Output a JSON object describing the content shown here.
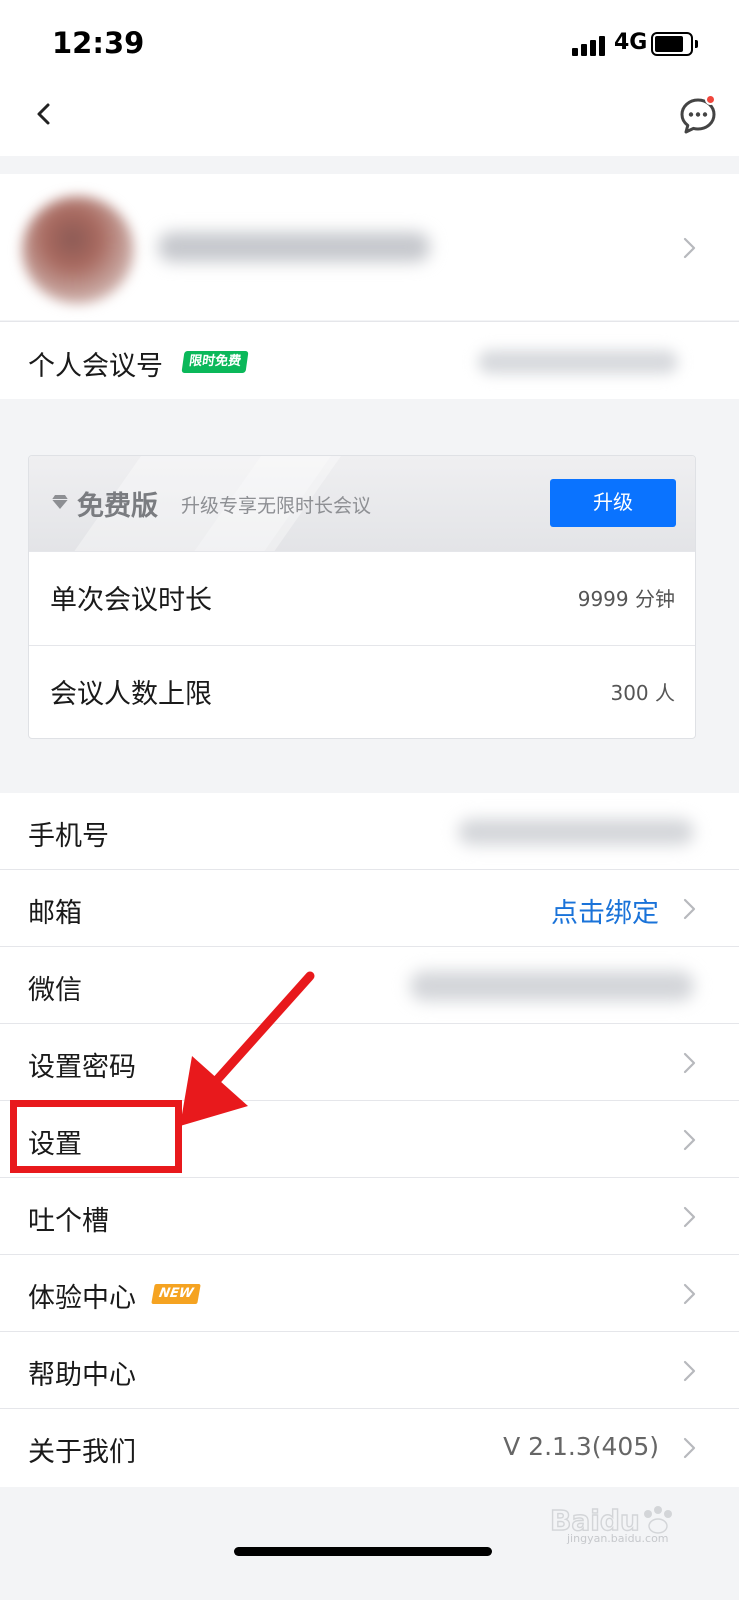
{
  "status_bar": {
    "time": "12:39",
    "network": "4G"
  },
  "nav": {
    "back_icon": "chevron-left-icon",
    "chat_icon": "chat-bubble-icon"
  },
  "profile": {
    "avatar_icon": "avatar"
  },
  "meeting": {
    "label": "个人会议号",
    "badge": "限时免费"
  },
  "plan": {
    "name": "免费版",
    "desc": "升级专享无限时长会议",
    "upgrade": "升级",
    "rows": [
      {
        "label": "单次会议时长",
        "value": "9999 分钟"
      },
      {
        "label": "会议人数上限",
        "value": "300 人"
      }
    ]
  },
  "list": {
    "phone": "手机号",
    "email": "邮箱",
    "email_action": "点击绑定",
    "wechat": "微信",
    "set_password": "设置密码",
    "settings": "设置",
    "feedback": "吐个槽",
    "experience": "体验中心",
    "experience_badge": "NEW",
    "help": "帮助中心",
    "about": "关于我们",
    "version": "V 2.1.3(405)"
  },
  "watermark": {
    "text": "jingyan.baidu.com"
  },
  "colors": {
    "accent": "#0a73ff",
    "link": "#1a73d9",
    "badge_green": "#0bb85a",
    "badge_orange": "#f5a321",
    "highlight": "#e8191c"
  }
}
